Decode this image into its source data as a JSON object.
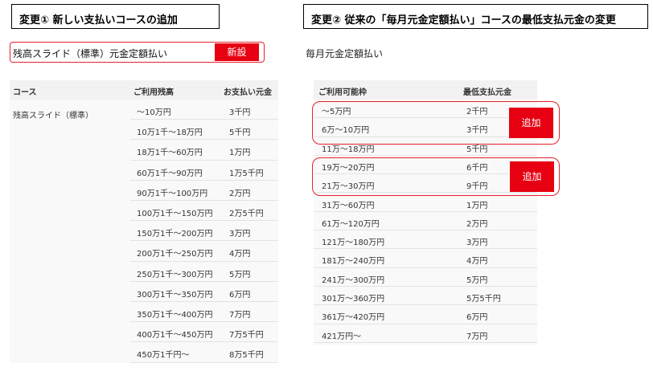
{
  "left": {
    "heading": "変更① 新しい支払いコースの追加",
    "new_course_label": "残高スライド（標準）元金定額払い",
    "new_button": "新設",
    "columns": [
      "コース",
      "ご利用残高",
      "お支払い元金"
    ],
    "course_name": "残高スライド（標準）",
    "rows": [
      {
        "balance": "～10万円",
        "payment": "3千円"
      },
      {
        "balance": "10万1千～18万円",
        "payment": "5千円"
      },
      {
        "balance": "18万1千～60万円",
        "payment": "1万円"
      },
      {
        "balance": "60万1千～90万円",
        "payment": "1万5千円"
      },
      {
        "balance": "90万1千～100万円",
        "payment": "2万円"
      },
      {
        "balance": "100万1千～150万円",
        "payment": "2万5千円"
      },
      {
        "balance": "150万1千～200万円",
        "payment": "3万円"
      },
      {
        "balance": "200万1千～250万円",
        "payment": "4万円"
      },
      {
        "balance": "250万1千～300万円",
        "payment": "5万円"
      },
      {
        "balance": "300万1千～350万円",
        "payment": "6万円"
      },
      {
        "balance": "350万1千～400万円",
        "payment": "7万円"
      },
      {
        "balance": "400万1千～450万円",
        "payment": "7万5千円"
      },
      {
        "balance": "450万1千円～",
        "payment": "8万5千円"
      }
    ]
  },
  "right": {
    "heading": "変更② 従来の「毎月元金定額払い」コースの最低支払元金の変更",
    "course_label": "毎月元金定額払い",
    "columns": [
      "ご利用可能枠",
      "最低支払元金"
    ],
    "add_button": "追加",
    "rows": [
      {
        "limit": "～5万円",
        "payment": "2千円"
      },
      {
        "limit": "6万～10万円",
        "payment": "3千円"
      },
      {
        "limit": "11万～18万円",
        "payment": "5千円"
      },
      {
        "limit": "19万～20万円",
        "payment": "6千円"
      },
      {
        "limit": "21万～30万円",
        "payment": "9千円"
      },
      {
        "limit": "31万～60万円",
        "payment": "1万円"
      },
      {
        "limit": "61万～120万円",
        "payment": "2万円"
      },
      {
        "limit": "121万～180万円",
        "payment": "3万円"
      },
      {
        "limit": "181万～240万円",
        "payment": "4万円"
      },
      {
        "limit": "241万～300万円",
        "payment": "5万円"
      },
      {
        "limit": "301万～360万円",
        "payment": "5万5千円"
      },
      {
        "limit": "361万～420万円",
        "payment": "6万円"
      },
      {
        "limit": "421万円～",
        "payment": "7万円"
      }
    ]
  }
}
